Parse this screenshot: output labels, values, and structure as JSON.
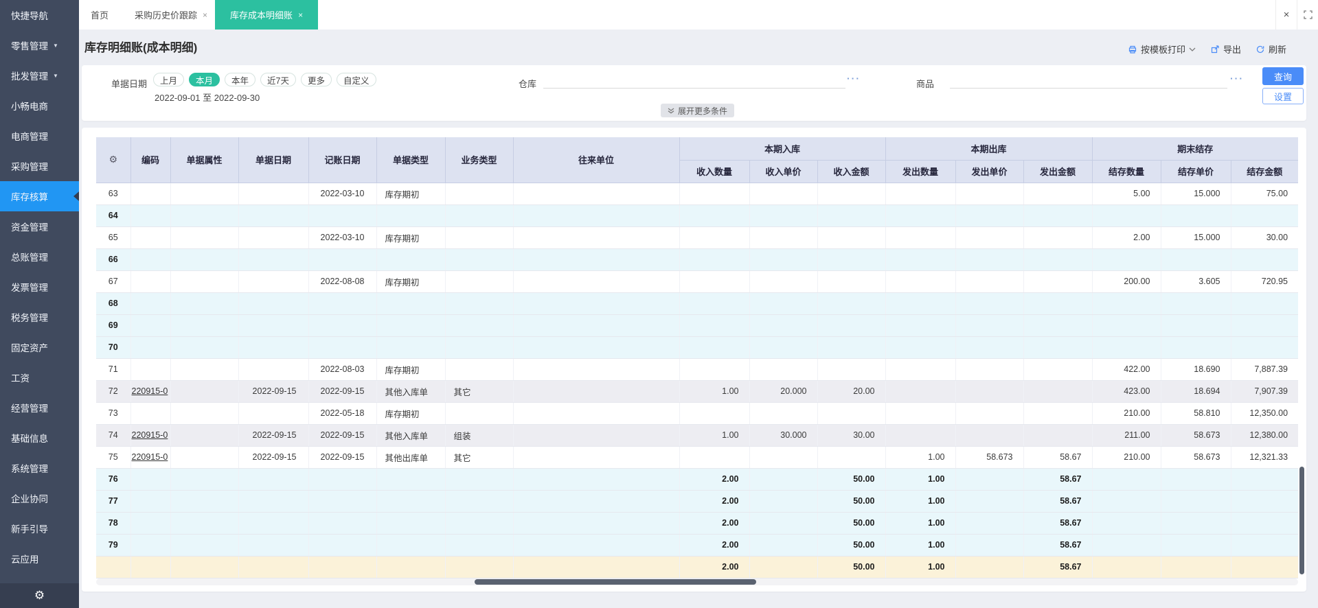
{
  "icons": {
    "gear": "⚙",
    "close": "×",
    "caret_down": "▼"
  },
  "sidebar": {
    "items": [
      {
        "label": "快捷导航"
      },
      {
        "label": "零售管理",
        "caret": true
      },
      {
        "label": "批发管理",
        "caret": true
      },
      {
        "label": "小畅电商"
      },
      {
        "label": "电商管理"
      },
      {
        "label": "采购管理"
      },
      {
        "label": "库存核算",
        "active": true
      },
      {
        "label": "资金管理"
      },
      {
        "label": "总账管理"
      },
      {
        "label": "发票管理"
      },
      {
        "label": "税务管理"
      },
      {
        "label": "固定资产"
      },
      {
        "label": "工资"
      },
      {
        "label": "经营管理"
      },
      {
        "label": "基础信息"
      },
      {
        "label": "系统管理"
      },
      {
        "label": "企业协同"
      },
      {
        "label": "新手引导"
      },
      {
        "label": "云应用"
      }
    ]
  },
  "tabs": [
    {
      "label": "首页",
      "closable": false,
      "active": false
    },
    {
      "label": "采购历史价跟踪",
      "closable": true,
      "active": false
    },
    {
      "label": "库存成本明细账",
      "closable": true,
      "active": true
    }
  ],
  "page": {
    "title": "库存明细账(成本明细)"
  },
  "toolbar": {
    "print_label": "按模板打印",
    "export_label": "导出",
    "refresh_label": "刷新"
  },
  "filters": {
    "date_label": "单据日期",
    "date_options": [
      "上月",
      "本月",
      "本年",
      "近7天",
      "更多",
      "自定义"
    ],
    "date_active_index": 1,
    "date_range": "2022-09-01 至 2022-09-30",
    "warehouse_label": "仓库",
    "warehouse_value": "",
    "product_label": "商品",
    "product_value": "",
    "ellipsis": "···",
    "query_button": "查询",
    "settings_button": "设置",
    "more_button": "展开更多条件"
  },
  "table": {
    "groups": {
      "inbound": "本期入库",
      "outbound": "本期出库",
      "balance": "期末结存"
    },
    "columns": {
      "code": "编码",
      "attr": "单据属性",
      "doc_date": "单据日期",
      "acc_date": "记账日期",
      "doc_type": "单据类型",
      "biz_type": "业务类型",
      "partner": "往来单位",
      "in_qty": "收入数量",
      "in_price": "收入单价",
      "in_amt": "收入金额",
      "out_qty": "发出数量",
      "out_price": "发出单价",
      "out_amt": "发出金额",
      "bal_qty": "结存数量",
      "bal_price": "结存单价",
      "bal_amt": "结存金额"
    },
    "rows": [
      {
        "num": "63",
        "acc_date": "2022-03-10",
        "doc_type": "库存期初",
        "bal_qty": "5.00",
        "bal_price": "15.000",
        "bal_amt": "75.00",
        "variant": "white"
      },
      {
        "num": "64",
        "variant": "cyan",
        "bold": true
      },
      {
        "num": "65",
        "acc_date": "2022-03-10",
        "doc_type": "库存期初",
        "bal_qty": "2.00",
        "bal_price": "15.000",
        "bal_amt": "30.00",
        "variant": "white"
      },
      {
        "num": "66",
        "variant": "cyan",
        "bold": true
      },
      {
        "num": "67",
        "acc_date": "2022-08-08",
        "doc_type": "库存期初",
        "bal_qty": "200.00",
        "bal_price": "3.605",
        "bal_amt": "720.95",
        "variant": "white"
      },
      {
        "num": "68",
        "variant": "cyan",
        "bold": true
      },
      {
        "num": "69",
        "variant": "cyan",
        "bold": true
      },
      {
        "num": "70",
        "variant": "cyan",
        "bold": true
      },
      {
        "num": "71",
        "acc_date": "2022-08-03",
        "doc_type": "库存期初",
        "bal_qty": "422.00",
        "bal_price": "18.690",
        "bal_amt": "7,887.39",
        "variant": "white"
      },
      {
        "num": "72",
        "code": "220915-0",
        "doc_date": "2022-09-15",
        "acc_date": "2022-09-15",
        "doc_type": "其他入库单",
        "biz_type": "其它",
        "in_qty": "1.00",
        "in_price": "20.000",
        "in_amt": "20.00",
        "bal_qty": "423.00",
        "bal_price": "18.694",
        "bal_amt": "7,907.39",
        "variant": "gray"
      },
      {
        "num": "73",
        "acc_date": "2022-05-18",
        "doc_type": "库存期初",
        "bal_qty": "210.00",
        "bal_price": "58.810",
        "bal_amt": "12,350.00",
        "variant": "white"
      },
      {
        "num": "74",
        "code": "220915-0",
        "doc_date": "2022-09-15",
        "acc_date": "2022-09-15",
        "doc_type": "其他入库单",
        "biz_type": "组装",
        "in_qty": "1.00",
        "in_price": "30.000",
        "in_amt": "30.00",
        "bal_qty": "211.00",
        "bal_price": "58.673",
        "bal_amt": "12,380.00",
        "variant": "gray"
      },
      {
        "num": "75",
        "code": "220915-0",
        "doc_date": "2022-09-15",
        "acc_date": "2022-09-15",
        "doc_type": "其他出库单",
        "biz_type": "其它",
        "out_qty": "1.00",
        "out_price": "58.673",
        "out_amt": "58.67",
        "bal_qty": "210.00",
        "bal_price": "58.673",
        "bal_amt": "12,321.33",
        "variant": "white"
      },
      {
        "num": "76",
        "in_qty": "2.00",
        "in_amt": "50.00",
        "out_qty": "1.00",
        "out_amt": "58.67",
        "variant": "cyan",
        "bold": true
      },
      {
        "num": "77",
        "in_qty": "2.00",
        "in_amt": "50.00",
        "out_qty": "1.00",
        "out_amt": "58.67",
        "variant": "cyan",
        "bold": true
      },
      {
        "num": "78",
        "in_qty": "2.00",
        "in_amt": "50.00",
        "out_qty": "1.00",
        "out_amt": "58.67",
        "variant": "cyan",
        "bold": true
      },
      {
        "num": "79",
        "in_qty": "2.00",
        "in_amt": "50.00",
        "out_qty": "1.00",
        "out_amt": "58.67",
        "variant": "cyan",
        "bold": true
      },
      {
        "num": "",
        "in_qty": "2.00",
        "in_amt": "50.00",
        "out_qty": "1.00",
        "out_amt": "58.67",
        "variant": "yellow",
        "bold": true
      }
    ]
  },
  "colors": {
    "sidebar_bg": "#404a5e",
    "sidebar_active": "#2196f3",
    "tab_active_green": "#2cc0a0",
    "button_blue": "#4a8cf8",
    "header_bg": "#dde2f1",
    "row_cyan": "#e9f7fb",
    "row_gray": "#ededf2",
    "row_yellow": "#fbf2d9",
    "page_bg": "#edeff4"
  }
}
